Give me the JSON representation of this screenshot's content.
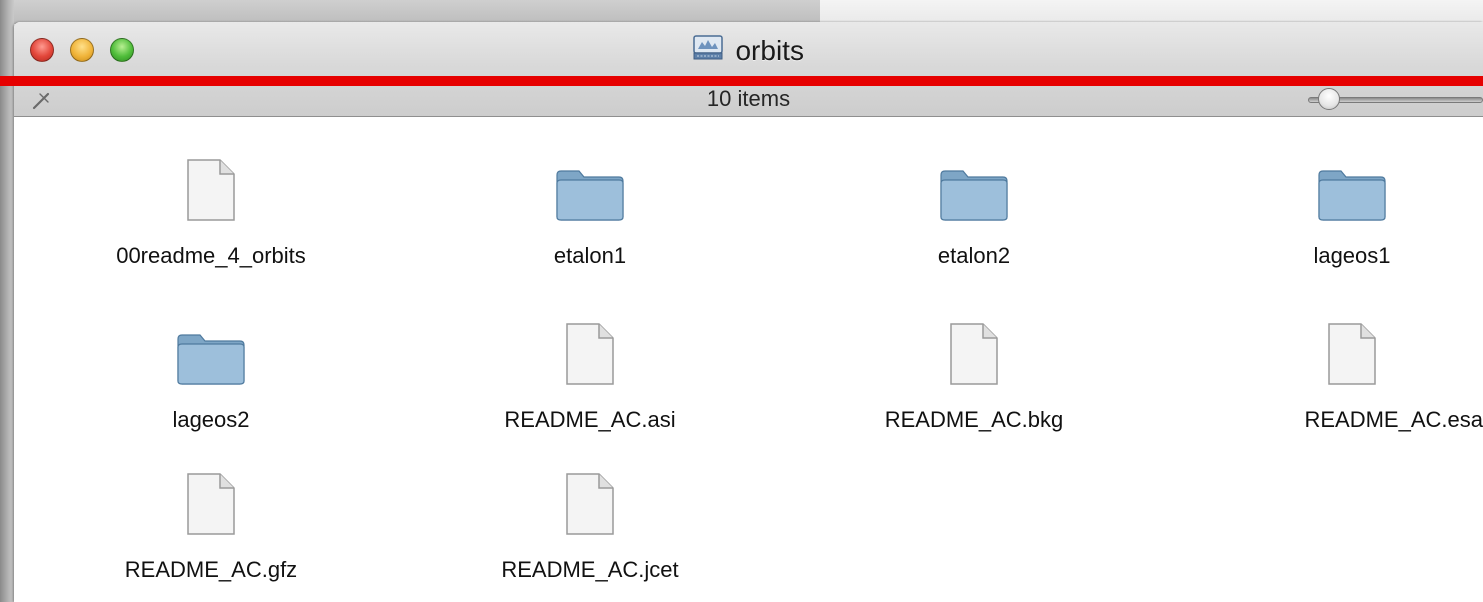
{
  "window": {
    "title": "orbits",
    "status": "10 items"
  },
  "items": [
    {
      "name": "00readme_4_orbits",
      "kind": "document-icon"
    },
    {
      "name": "etalon1",
      "kind": "folder-icon"
    },
    {
      "name": "etalon2",
      "kind": "folder-icon"
    },
    {
      "name": "lageos1",
      "kind": "folder-icon"
    },
    {
      "name": "lageos2",
      "kind": "folder-icon"
    },
    {
      "name": "README_AC.asi",
      "kind": "document-icon"
    },
    {
      "name": "README_AC.bkg",
      "kind": "document-icon"
    },
    {
      "name": "README_AC.esa",
      "kind": "document-icon"
    },
    {
      "name": "README_AC.gfz",
      "kind": "document-icon"
    },
    {
      "name": "README_AC.jcet",
      "kind": "document-icon"
    }
  ],
  "colors": {
    "annotation_line": "#e60000",
    "folder": "#8fb3cf"
  }
}
